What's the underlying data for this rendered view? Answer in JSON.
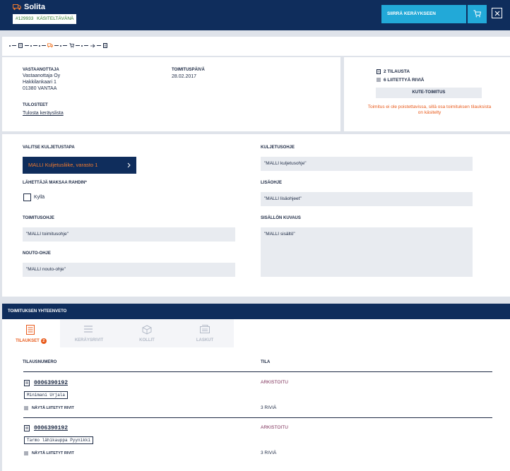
{
  "header": {
    "title": "Solita",
    "order_ref": "#129933",
    "status": "KÄSITELTÄVÄNÄ",
    "move_button": "SIIRRÄ KERÄYKSEEN",
    "truck_icon": "truck-icon",
    "cart_icon": "cart-icon",
    "close_icon": "close-icon",
    "colors": {
      "bar": "#0f2d5c",
      "accent": "#22a9d8",
      "status_text": "#2b7a2b"
    }
  },
  "steps": {
    "icons": [
      "document-icon",
      "truck-icon",
      "cart-icon",
      "arrow-right-icon",
      "invoice-icon"
    ]
  },
  "recipient": {
    "label": "VASTAANOTTAJA",
    "name": "Vastaanottaja Oy",
    "street": "Hakkilankaari 1",
    "city": "01380 VANTAA"
  },
  "delivery_date": {
    "label": "TOIMITUSPÄIVÄ",
    "value": "28.02.2017"
  },
  "prints": {
    "label": "TULOSTEET",
    "link": "Tulosta keräyslista"
  },
  "order_info": {
    "orders": "2 TILAUSTA",
    "rows": "6 LIITETTYÄ RIVIÄ",
    "kute_button": "KUTE-TOIMITUS",
    "warning": "Toimitus ei ole poistettavissa, sillä osa toimituksen tilauksista on käsitelty",
    "warning_color": "#e85a1b"
  },
  "form": {
    "carrier_label": "VALITSE KULJETUSTAPA",
    "carrier_value": "MALLI Kuljetusliike, varasto 1",
    "sender_pays_label": "LÄHETTÄJÄ MAKSAA RAHDIN*",
    "sender_pays_option": "Kyllä",
    "delivery_instr_label": "TOIMITUSOHJE",
    "delivery_instr_value": "\"MALLI toimitusohje\"",
    "pickup_label": "NOUTO-OHJE",
    "pickup_value": "\"MALLI nouto-ohje\"",
    "transport_label": "KULJETUSOHJE",
    "transport_value": "\"MALLI kuljetusohje\"",
    "extra_label": "LISÄOHJE",
    "extra_value": "\"MALLI lisäohjeet\"",
    "content_label": "SISÄLLÖN KUVAUS",
    "content_value": "\"MALLI sisältö\""
  },
  "summary": {
    "title": "TOIMITUKSEN YHTEENVETO",
    "tabs": [
      {
        "label": "TILAUKSET",
        "badge": "2",
        "icon": "orders-icon"
      },
      {
        "label": "KERÄYSRIVIT",
        "icon": "list-icon"
      },
      {
        "label": "KOLLIT",
        "icon": "box-icon"
      },
      {
        "label": "LASKUT",
        "icon": "invoice-icon"
      }
    ],
    "col_order": "TILAUSNUMERO",
    "col_status": "TILA",
    "rows": [
      {
        "number": "0006390192",
        "customer": "Minimani Urjala",
        "status": "ARKISTOITU",
        "show_rows": "NÄYTÄ LIITETYT RIVIT",
        "row_count": "3 RIVIÄ"
      },
      {
        "number": "0006390192",
        "customer": "Tarmo lähikauppa Pyynikki",
        "status": "ARKISTOITU",
        "show_rows": "NÄYTÄ LIITETYT RIVIT",
        "row_count": "3 RIVIÄ"
      }
    ]
  }
}
